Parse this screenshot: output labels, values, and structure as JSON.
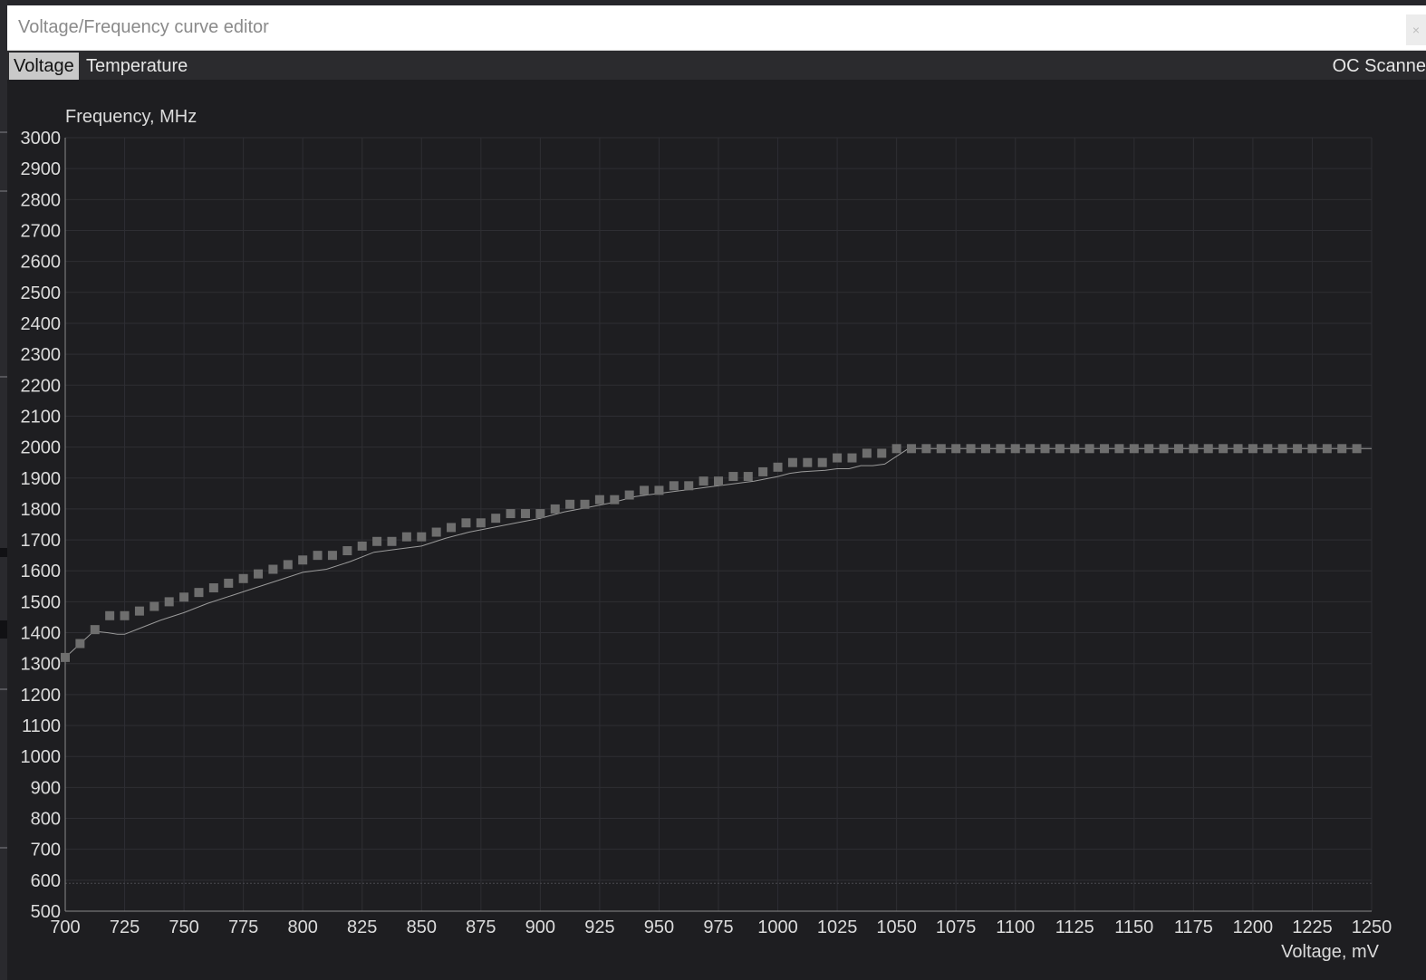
{
  "window": {
    "title": "Voltage/Frequency curve editor",
    "close_glyph": "×"
  },
  "tabs": [
    {
      "label": "Voltage",
      "active": true
    },
    {
      "label": "Temperature",
      "active": false
    }
  ],
  "scanner_label": "OC Scanne",
  "colors": {
    "background": "#1e1e21",
    "grid": "#2e2e33",
    "curve_points": "#6e6e6e",
    "curve_line": "#9a9a9a",
    "text": "#dcdcdc"
  },
  "chart_data": {
    "type": "line",
    "ylabel": "Frequency, MHz",
    "xlabel": "Voltage, mV",
    "xlim": [
      700,
      1250
    ],
    "ylim": [
      500,
      3000
    ],
    "xticks": [
      700,
      725,
      750,
      775,
      800,
      825,
      850,
      875,
      900,
      925,
      950,
      975,
      1000,
      1025,
      1050,
      1075,
      1100,
      1125,
      1150,
      1175,
      1200,
      1225,
      1250
    ],
    "yticks": [
      500,
      600,
      700,
      800,
      900,
      1000,
      1100,
      1200,
      1300,
      1400,
      1500,
      1600,
      1700,
      1800,
      1900,
      2000,
      2100,
      2200,
      2300,
      2400,
      2500,
      2600,
      2700,
      2800,
      2900,
      3000
    ],
    "grid": true,
    "reference_line_y": 590,
    "series": [
      {
        "role": "points",
        "x": [
          700,
          706.25,
          712.5,
          718.75,
          725,
          731.25,
          737.5,
          743.75,
          750,
          756.25,
          762.5,
          768.75,
          775,
          781.25,
          787.5,
          793.75,
          800,
          806.25,
          812.5,
          818.75,
          825,
          831.25,
          837.5,
          843.75,
          850,
          856.25,
          862.5,
          868.75,
          875,
          881.25,
          887.5,
          893.75,
          900,
          906.25,
          912.5,
          918.75,
          925,
          931.25,
          937.5,
          943.75,
          950,
          956.25,
          962.5,
          968.75,
          975,
          981.25,
          987.5,
          993.75,
          1000,
          1006.25,
          1012.5,
          1018.75,
          1025,
          1031.25,
          1037.5,
          1043.75,
          1050,
          1056.25,
          1062.5,
          1068.75,
          1075,
          1081.25,
          1087.5,
          1093.75,
          1100,
          1106.25,
          1112.5,
          1118.75,
          1125,
          1131.25,
          1137.5,
          1143.75,
          1150,
          1156.25,
          1162.5,
          1168.75,
          1175,
          1181.25,
          1187.5,
          1193.75,
          1200,
          1206.25,
          1212.5,
          1218.75,
          1225,
          1231.25,
          1237.5,
          1243.75
        ],
        "y": [
          1320,
          1365,
          1410,
          1455,
          1455,
          1470,
          1485,
          1500,
          1515,
          1530,
          1545,
          1560,
          1575,
          1590,
          1605,
          1620,
          1635,
          1650,
          1650,
          1665,
          1680,
          1695,
          1695,
          1710,
          1710,
          1725,
          1740,
          1755,
          1755,
          1770,
          1785,
          1785,
          1785,
          1800,
          1815,
          1815,
          1830,
          1830,
          1845,
          1860,
          1860,
          1875,
          1875,
          1890,
          1890,
          1905,
          1905,
          1920,
          1935,
          1950,
          1950,
          1950,
          1965,
          1965,
          1980,
          1980,
          1995,
          1995,
          1995,
          1995,
          1995,
          1995,
          1995,
          1995,
          1995,
          1995,
          1995,
          1995,
          1995,
          1995,
          1995,
          1995,
          1995,
          1995,
          1995,
          1995,
          1995,
          1995,
          1995,
          1995,
          1995,
          1995,
          1995,
          1995,
          1995,
          1995,
          1995,
          1995
        ]
      },
      {
        "role": "curve",
        "x": [
          700,
          706,
          712,
          718,
          722,
          725,
          730,
          740,
          750,
          760,
          770,
          780,
          790,
          800,
          810,
          820,
          830,
          840,
          850,
          860,
          870,
          880,
          890,
          900,
          910,
          920,
          930,
          940,
          950,
          960,
          970,
          980,
          990,
          1000,
          1005,
          1010,
          1020,
          1025,
          1030,
          1035,
          1040,
          1045,
          1050,
          1055,
          1250
        ],
        "y": [
          1320,
          1362,
          1405,
          1400,
          1395,
          1395,
          1410,
          1440,
          1465,
          1495,
          1520,
          1545,
          1570,
          1595,
          1605,
          1630,
          1660,
          1670,
          1680,
          1705,
          1725,
          1740,
          1755,
          1770,
          1790,
          1805,
          1820,
          1840,
          1850,
          1860,
          1870,
          1880,
          1890,
          1905,
          1915,
          1920,
          1925,
          1930,
          1930,
          1940,
          1940,
          1945,
          1970,
          1995,
          1995
        ]
      }
    ]
  }
}
